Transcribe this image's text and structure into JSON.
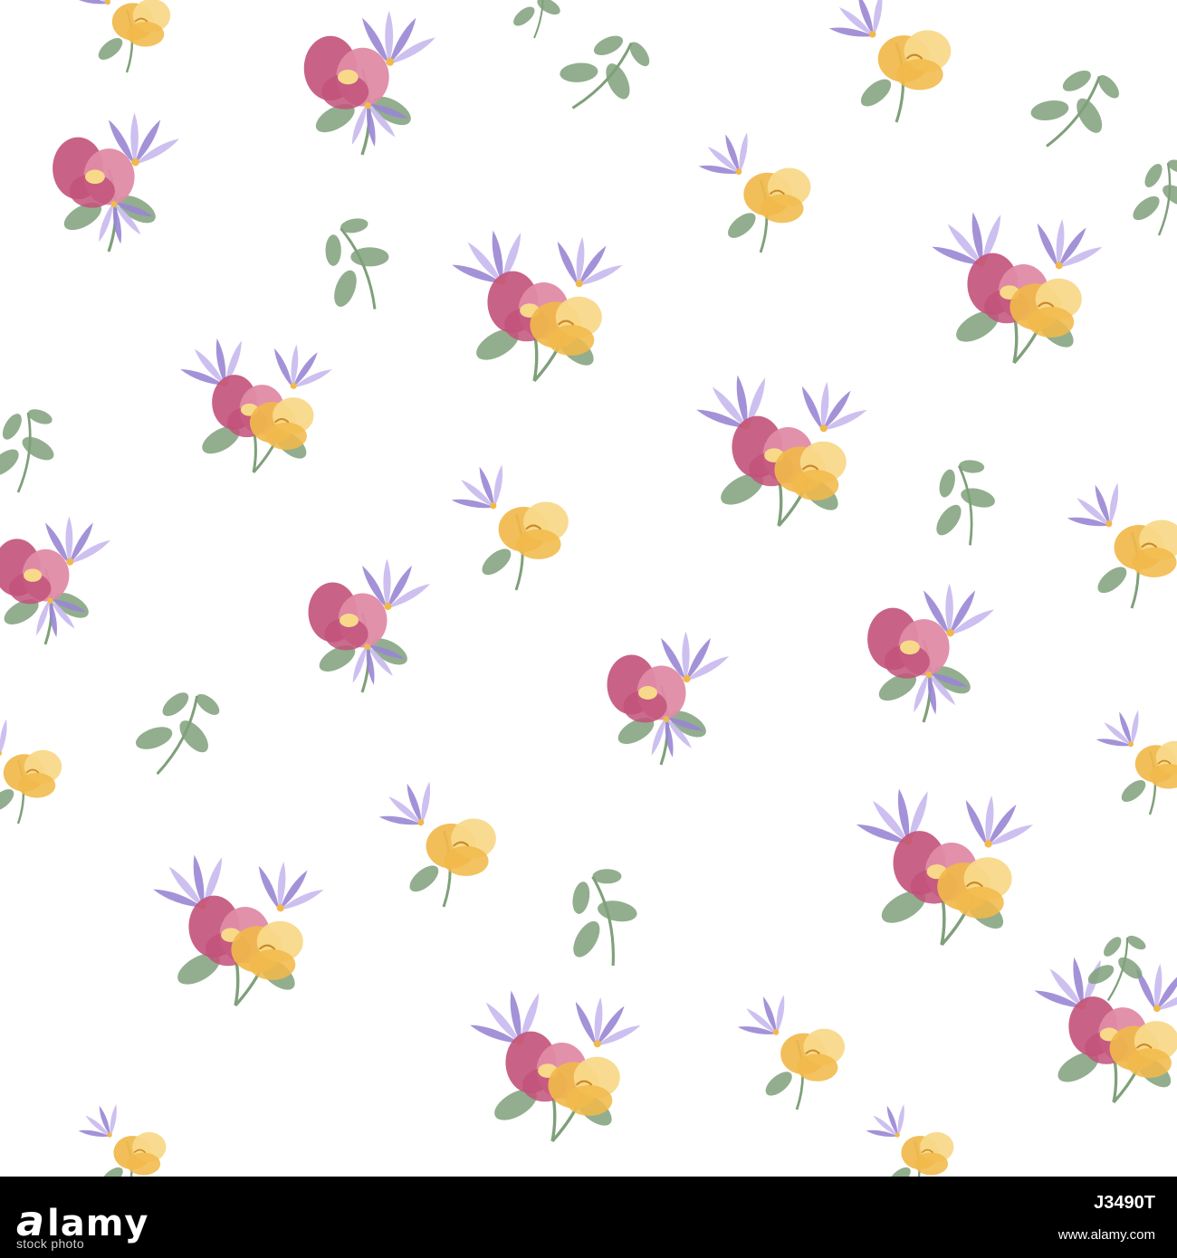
{
  "watermark": {
    "brand": "alamy",
    "stock_photo_label": "stock photo",
    "image_id": "J3490T",
    "site_url": "www.alamy.com"
  },
  "colors": {
    "background": "#ffffff",
    "pink": "#c2527a",
    "pink_light": "#e08ba6",
    "purple": "#9a86d4",
    "purple_light": "#c8b9ee",
    "yellow": "#f1b94b",
    "yellow_light": "#f8d98a",
    "leaf": "#7fa07a",
    "leaf_light": "#a8c29a",
    "footer": "#000000"
  },
  "pattern": {
    "motif_names": [
      "pink-flower",
      "purple-flower",
      "yellow-flower",
      "leaf-sprig",
      "bouquet"
    ]
  }
}
